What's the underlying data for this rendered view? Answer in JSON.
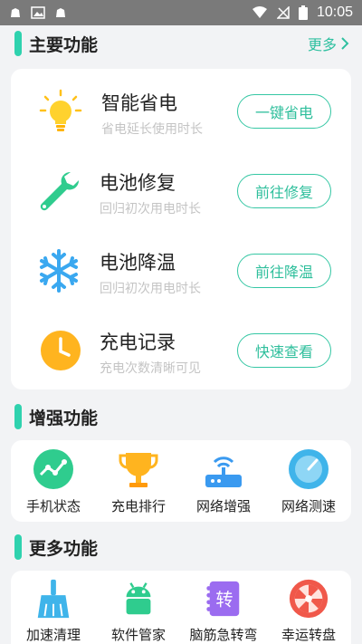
{
  "status_bar": {
    "time": "10:05"
  },
  "main_section": {
    "title": "主要功能",
    "more_label": "更多",
    "features": [
      {
        "title": "智能省电",
        "subtitle": "省电延长使用时长",
        "button": "一键省电",
        "icon": "lightbulb-icon"
      },
      {
        "title": "电池修复",
        "subtitle": "回归初次用电时长",
        "button": "前往修复",
        "icon": "wrench-icon"
      },
      {
        "title": "电池降温",
        "subtitle": "回归初次用电时长",
        "button": "前往降温",
        "icon": "snowflake-icon"
      },
      {
        "title": "充电记录",
        "subtitle": "充电次数清晰可见",
        "button": "快速查看",
        "icon": "clock-icon"
      }
    ]
  },
  "enhance_section": {
    "title": "增强功能",
    "items": [
      {
        "label": "手机状态",
        "icon": "phone-status-icon"
      },
      {
        "label": "充电排行",
        "icon": "trophy-icon"
      },
      {
        "label": "网络增强",
        "icon": "router-icon"
      },
      {
        "label": "网络测速",
        "icon": "speedometer-icon"
      }
    ]
  },
  "more_section": {
    "title": "更多功能",
    "items": [
      {
        "label": "加速清理",
        "icon": "broom-icon"
      },
      {
        "label": "软件管家",
        "icon": "android-icon"
      },
      {
        "label": "脑筋急转弯",
        "icon": "brain-teaser-icon",
        "badge": "转"
      },
      {
        "label": "幸运转盘",
        "icon": "lucky-wheel-icon"
      }
    ]
  },
  "colors": {
    "accent": "#2fd2ae",
    "button_text": "#2fbf9c",
    "subtitle": "#c4c4c4",
    "statusbar": "#7a7a7a"
  }
}
